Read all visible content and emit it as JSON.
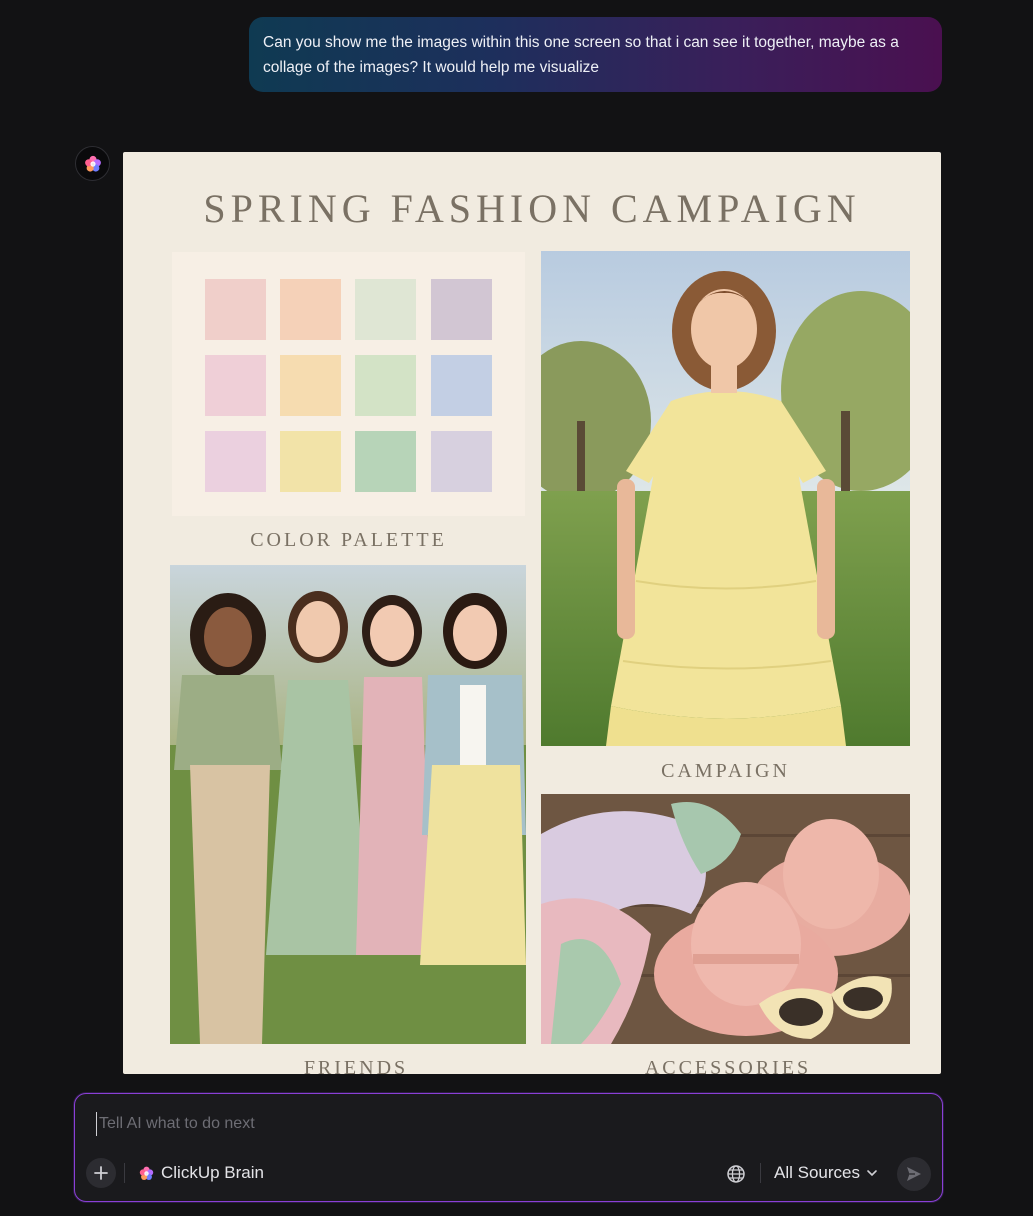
{
  "chat": {
    "user_message": "Can you show me the images within this one screen so that i can see it together, maybe as a collage of the images? It would help me visualize",
    "ai_avatar_icon": "clickup-brain-icon"
  },
  "collage": {
    "title": "SPRING FASHION CAMPAIGN",
    "captions": {
      "palette": "COLOR PALETTE",
      "campaign": "CAMPAIGN",
      "friends": "FRIENDS",
      "accessories": "ACCESSORIES"
    },
    "palette_colors": [
      "#f0cfca",
      "#f5d1b8",
      "#dfe6d4",
      "#d2c6d3",
      "#efcfd7",
      "#f6dcb0",
      "#d3e3c6",
      "#c3cfe4",
      "#ebd0df",
      "#f2e3a8",
      "#b7d4b8",
      "#d7d0df"
    ],
    "background": "#f1ebe0"
  },
  "composer": {
    "placeholder": "Tell AI what to do next",
    "value": "",
    "brain_label": "ClickUp Brain",
    "sources_label": "All Sources",
    "accent": "#8a3fd6",
    "icons": {
      "add": "plus-icon",
      "globe": "globe-icon",
      "chevron": "chevron-down-icon",
      "send": "send-icon"
    }
  }
}
